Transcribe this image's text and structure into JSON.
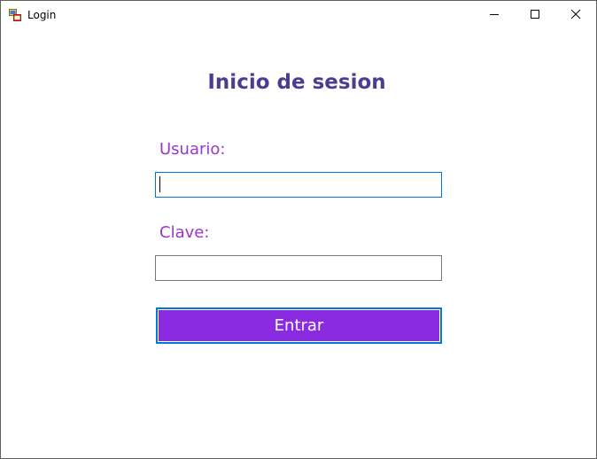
{
  "window": {
    "title": "Login",
    "controls": [
      "minimize-icon",
      "maximize-icon",
      "close-icon"
    ]
  },
  "form": {
    "heading": "Inicio de sesion",
    "user_label": "Usuario:",
    "user_value": "",
    "password_label": "Clave:",
    "password_value": "",
    "submit_label": "Entrar"
  },
  "colors": {
    "heading": "#4b3d94",
    "labels": "#9a36c8",
    "button_fill": "#8a2be2",
    "focus_border": "#0078d7"
  }
}
